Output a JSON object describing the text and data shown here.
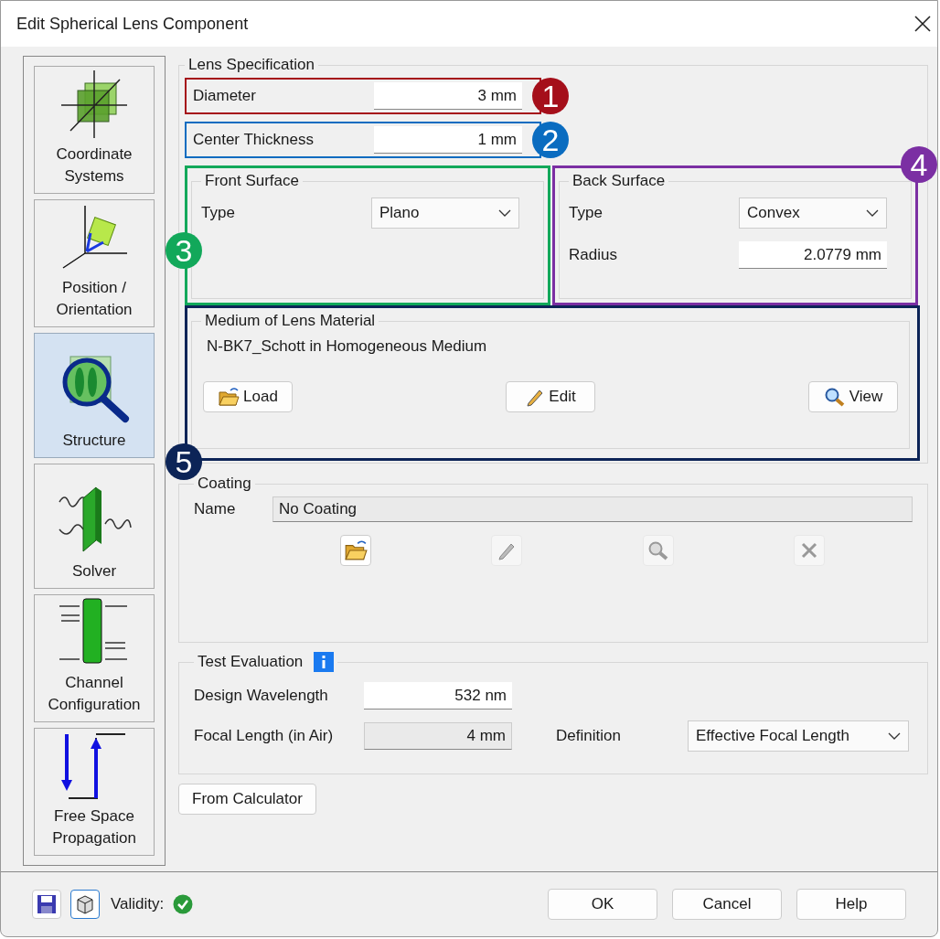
{
  "window": {
    "title": "Edit Spherical Lens Component"
  },
  "nav": [
    {
      "label": "Coordinate Systems",
      "kind": "coords",
      "selected": false
    },
    {
      "label": "Position / Orientation",
      "kind": "position",
      "selected": false
    },
    {
      "label": "Structure",
      "kind": "structure",
      "selected": true
    },
    {
      "label": "Solver",
      "kind": "solver",
      "selected": false
    },
    {
      "label": "Channel Configuration",
      "kind": "channel",
      "selected": false
    },
    {
      "label": "Free Space Propagation",
      "kind": "propagation",
      "selected": false
    }
  ],
  "lens_spec": {
    "title": "Lens Specification",
    "diameter": {
      "label": "Diameter",
      "value": "3 mm",
      "callout": {
        "number": "1",
        "color": "#a50f1a"
      }
    },
    "thickness": {
      "label": "Center Thickness",
      "value": "1 mm",
      "callout": {
        "number": "2",
        "color": "#0a6cc0"
      }
    },
    "front": {
      "title": "Front Surface",
      "type_label": "Type",
      "type": "Plano",
      "callout": {
        "number": "3",
        "color": "#12a85a"
      }
    },
    "back": {
      "title": "Back Surface",
      "type_label": "Type",
      "type": "Convex",
      "radius_label": "Radius",
      "radius": "2.0779 mm",
      "callout": {
        "number": "4",
        "color": "#7b2fa3"
      }
    },
    "medium": {
      "title": "Medium of Lens Material",
      "text": "N-BK7_Schott in Homogeneous Medium",
      "callout": {
        "number": "5",
        "color": "#0c2457"
      },
      "buttons": [
        {
          "label": "Load",
          "kind": "load"
        },
        {
          "label": "Edit",
          "kind": "edit"
        },
        {
          "label": "View",
          "kind": "view"
        }
      ]
    }
  },
  "coating": {
    "title": "Coating",
    "name_label": "Name",
    "name": "No Coating",
    "tools": [
      {
        "kind": "load",
        "disabled": false
      },
      {
        "kind": "edit",
        "disabled": true
      },
      {
        "kind": "view",
        "disabled": true
      },
      {
        "kind": "remove",
        "disabled": true
      }
    ]
  },
  "test": {
    "title": "Test Evaluation",
    "wavelength_label": "Design Wavelength",
    "wavelength": "532 nm",
    "focal_label": "Focal Length (in Air)",
    "focal": "4 mm",
    "definition_label": "Definition",
    "definition": "Effective Focal Length"
  },
  "from_calculator": "From Calculator",
  "footer": {
    "validity": "Validity:",
    "valid": true,
    "buttons": [
      "OK",
      "Cancel",
      "Help"
    ]
  }
}
